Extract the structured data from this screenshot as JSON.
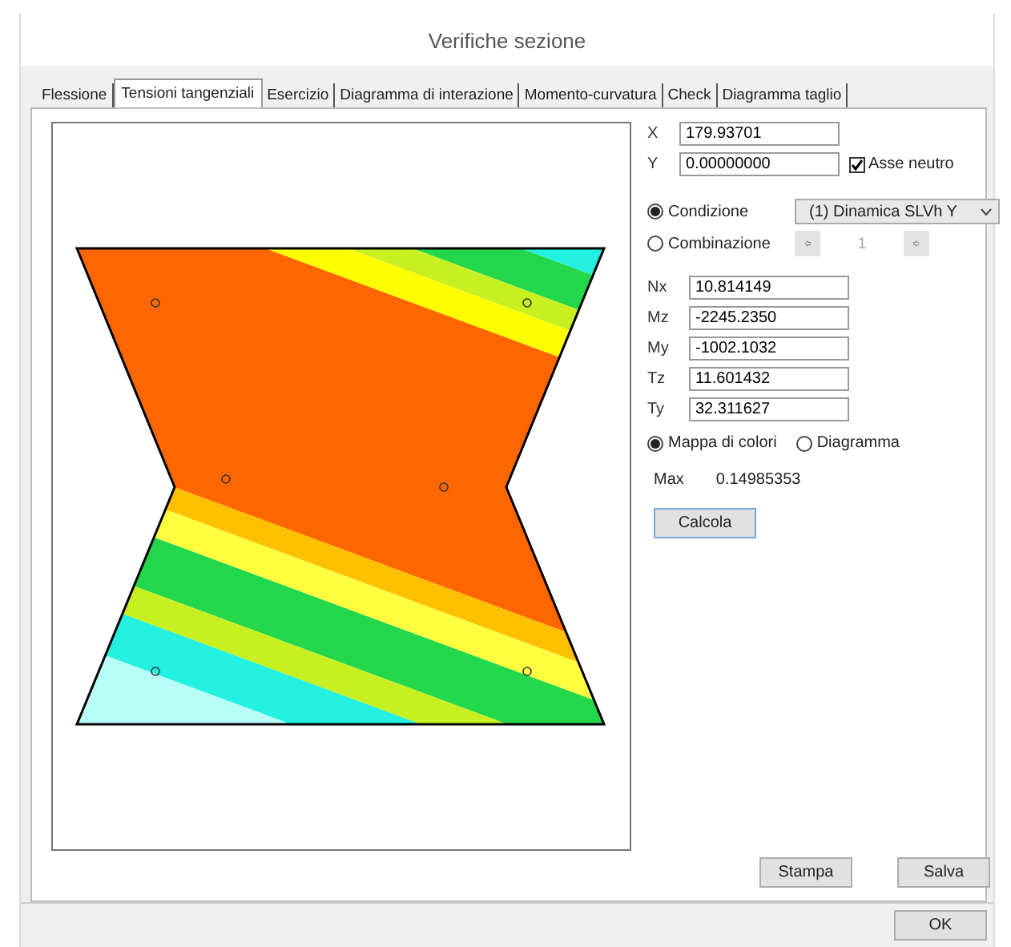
{
  "window": {
    "title": "Verifiche sezione"
  },
  "tabs": [
    {
      "label": "Flessione",
      "selected": false
    },
    {
      "label": "Tensioni tangenziali",
      "selected": true
    },
    {
      "label": "Esercizio",
      "selected": false
    },
    {
      "label": "Diagramma di interazione",
      "selected": false
    },
    {
      "label": "Momento-curvatura",
      "selected": false
    },
    {
      "label": "Check",
      "selected": false
    },
    {
      "label": "Diagramma taglio",
      "selected": false
    }
  ],
  "coords": [
    {
      "label": "X",
      "value": "179.93701"
    },
    {
      "label": "Y",
      "value": "0.00000000"
    }
  ],
  "neutral_axis": {
    "label": "Asse neutro",
    "checked": true
  },
  "source": [
    {
      "label": "Condizione",
      "selected": true
    },
    {
      "label": "Combinazione",
      "selected": false
    }
  ],
  "condition_dropdown": {
    "value": "(1) Dinamica SLVh Y"
  },
  "combination_spinner": {
    "value": "1",
    "disabled": true
  },
  "forces": [
    {
      "label": "Nx",
      "value": "10.814149"
    },
    {
      "label": "Mz",
      "value": "-2245.2350"
    },
    {
      "label": "My",
      "value": "-1002.1032"
    },
    {
      "label": "Tz",
      "value": "11.601432"
    },
    {
      "label": "Ty",
      "value": "32.311627"
    }
  ],
  "view_mode": [
    {
      "label": "Mappa di colori",
      "selected": true
    },
    {
      "label": "Diagramma",
      "selected": false
    }
  ],
  "max": {
    "label": "Max",
    "value": "0.14985353"
  },
  "calc_button": "Calcola",
  "action_buttons": [
    "Stampa",
    "Salva"
  ],
  "ok_button": "OK"
}
